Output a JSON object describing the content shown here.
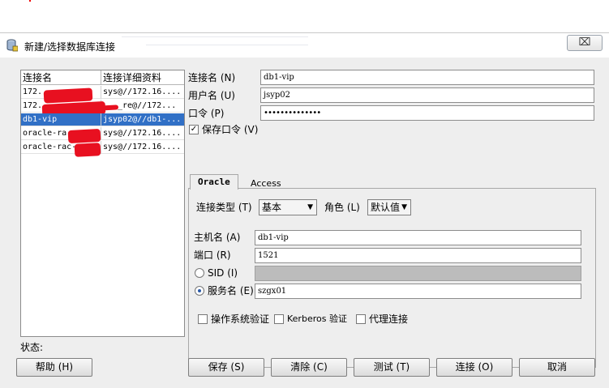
{
  "window": {
    "title": "新建/选择数据库连接",
    "close_glyph": "⌧"
  },
  "connection_list": {
    "headers": [
      "连接名",
      "连接详细资料"
    ],
    "rows": [
      {
        "name": "172.",
        "details": "sys@//172.16....",
        "selected": false
      },
      {
        "name": "172.",
        "details": "_re@//172...",
        "selected": false
      },
      {
        "name": "db1-vip",
        "details": "jsyp02@//db1-...",
        "selected": true
      },
      {
        "name": "oracle-ra",
        "details": "sys@//172.16....",
        "selected": false
      },
      {
        "name": "oracle-rac-",
        "details": "sys@//172.16....",
        "selected": false
      }
    ]
  },
  "form": {
    "conn_name_label": "连接名 (N)",
    "conn_name_value": "db1-vip",
    "username_label": "用户名 (U)",
    "username_value": "jsyp02",
    "password_label": "口令 (P)",
    "password_value": "••••••••••••••",
    "save_password_label": "保存口令 (V)",
    "save_password_checked": true
  },
  "tabs": [
    "Oracle",
    "Access"
  ],
  "oracle": {
    "conn_type_label": "连接类型 (T)",
    "conn_type_value": "基本",
    "role_label": "角色 (L)",
    "role_value": "默认值",
    "host_label": "主机名 (A)",
    "host_value": "db1-vip",
    "port_label": "端口 (R)",
    "port_value": "1521",
    "sid_label": "SID (I)",
    "sid_value": "",
    "service_label": "服务名 (E)",
    "service_value": "szgx01",
    "os_auth_label": "操作系统验证",
    "kerberos_label": "Kerberos 验证",
    "proxy_label": "代理连接"
  },
  "status_label": "状态:",
  "buttons": {
    "help": "帮助 (H)",
    "save": "保存 (S)",
    "clear": "清除 (C)",
    "test": "测试 (T)",
    "connect": "连接 (O)",
    "cancel": "取消"
  }
}
